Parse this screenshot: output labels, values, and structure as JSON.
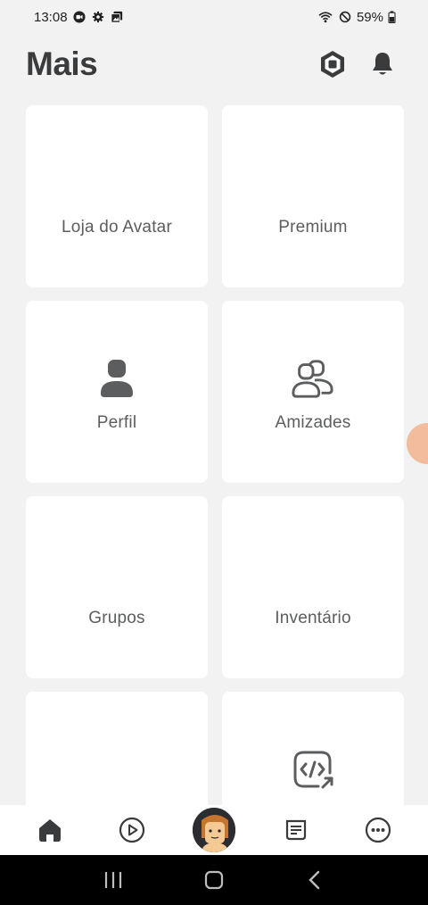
{
  "status_bar": {
    "time": "13:08",
    "battery": "59%"
  },
  "header": {
    "title": "Mais",
    "robux_icon": "robux-icon",
    "notifications_icon": "bell-icon"
  },
  "tiles": [
    {
      "label": "Loja do Avatar",
      "icon": ""
    },
    {
      "label": "Premium",
      "icon": ""
    },
    {
      "label": "Perfil",
      "icon": "person-icon"
    },
    {
      "label": "Amizades",
      "icon": "friends-icon"
    },
    {
      "label": "Grupos",
      "icon": ""
    },
    {
      "label": "Inventário",
      "icon": ""
    },
    {
      "label": "",
      "icon": ""
    },
    {
      "label": "",
      "icon": "code-share-icon"
    }
  ],
  "bottom_nav": {
    "items": [
      "home-icon",
      "play-icon",
      "avatar",
      "chat-icon",
      "more-icon"
    ]
  },
  "colors": {
    "background": "#f2f2f2",
    "tile": "#ffffff",
    "text": "#393b3d"
  }
}
